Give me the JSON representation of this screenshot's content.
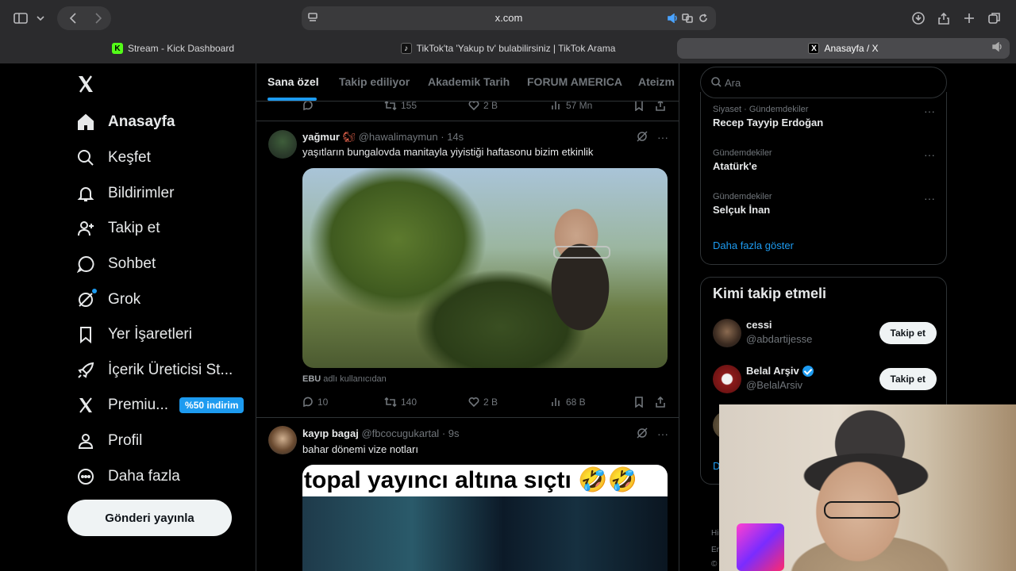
{
  "browser": {
    "url": "x.com",
    "tabs": [
      {
        "label": "Stream - Kick Dashboard",
        "favicon": "K",
        "active": false
      },
      {
        "label": "TikTok'ta 'Yakup tv' bulabilirsiniz | TikTok Arama",
        "favicon": "tiktok",
        "active": false
      },
      {
        "label": "Anasayfa / X",
        "favicon": "X",
        "active": true
      }
    ]
  },
  "leftnav": {
    "items": [
      {
        "label": "Anasayfa",
        "icon": "home-icon"
      },
      {
        "label": "Keşfet",
        "icon": "search-icon"
      },
      {
        "label": "Bildirimler",
        "icon": "bell-icon"
      },
      {
        "label": "Takip et",
        "icon": "add-user-icon"
      },
      {
        "label": "Sohbet",
        "icon": "chat-icon"
      },
      {
        "label": "Grok",
        "icon": "grok-icon"
      },
      {
        "label": "Yer İşaretleri",
        "icon": "bookmark-icon"
      },
      {
        "label": "İçerik Üreticisi St...",
        "icon": "rocket-icon"
      },
      {
        "label": "Premiu...",
        "icon": "x-icon",
        "badge": "%50 indirim"
      },
      {
        "label": "Profil",
        "icon": "person-icon"
      },
      {
        "label": "Daha fazla",
        "icon": "more-icon"
      }
    ],
    "post_button": "Gönderi yayınla"
  },
  "feed": {
    "tabs": [
      "Sana özel",
      "Takip ediliyor",
      "Akademik Tarih",
      "FORUM AMERICA",
      "Ateizm"
    ],
    "prev_actions": {
      "retweets": "155",
      "likes": "2 B",
      "views": "57 Mn"
    },
    "tweet1": {
      "name": "yağmur",
      "handle": "@hawalimaymun",
      "time": "· 14s",
      "text": "yaşıtların bungalovda manitayla yiyistiği haftasonu bizim etkinlik",
      "source_user": "EBU",
      "source_suffix": "adlı kullanıcıdan",
      "replies": "10",
      "retweets": "140",
      "likes": "2 B",
      "views": "68 B"
    },
    "tweet2": {
      "name": "kayıp bagaj",
      "handle": "@fbcocugukartal",
      "time": "· 9s",
      "text": "bahar dönemi vize notları",
      "media_caption": "topal yayıncı altına sıçtı 🤣🤣"
    }
  },
  "right": {
    "search_placeholder": "Ara",
    "trends": [
      {
        "category": "Siyaset · Gündemdekiler",
        "name": "Recep Tayyip Erdoğan"
      },
      {
        "category": "Gündemdekiler",
        "name": "Atatürk'e"
      },
      {
        "category": "Gündemdekiler",
        "name": "Selçuk İnan"
      }
    ],
    "show_more": "Daha fazla göster",
    "who_to_follow": {
      "title": "Kimi takip etmeli",
      "users": [
        {
          "name": "cessi",
          "handle": "@abdartijesse",
          "button": "Takip et",
          "verified": false
        },
        {
          "name": "Belal Arşiv",
          "handle": "@BelalArsiv",
          "button": "Takip et",
          "verified": true
        }
      ],
      "partial_link": "D"
    },
    "footer_fragments": [
      "Hi",
      "Er",
      "©"
    ]
  },
  "colors": {
    "accent": "#1d9bf0",
    "background": "#000000",
    "text": "#e7e9ea",
    "muted": "#71767b"
  }
}
